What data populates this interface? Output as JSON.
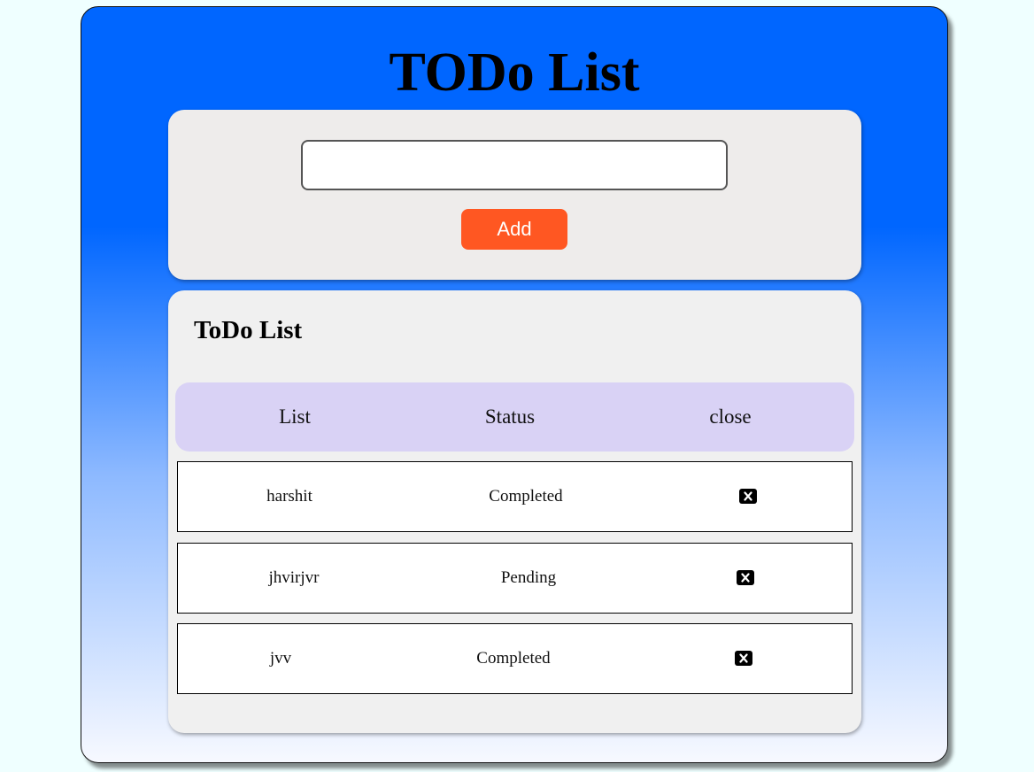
{
  "app": {
    "title": "TODo List"
  },
  "form": {
    "input_value": "",
    "input_placeholder": "",
    "add_label": "Add"
  },
  "list": {
    "title": "ToDo List",
    "headers": {
      "list": "List",
      "status": "Status",
      "close": "close"
    },
    "items": [
      {
        "name": "harshit",
        "status": "Completed",
        "close_icon": "close-icon"
      },
      {
        "name": "jhvirjvr",
        "status": "Pending",
        "close_icon": "close-icon"
      },
      {
        "name": "jvv",
        "status": "Completed",
        "close_icon": "close-icon"
      }
    ]
  },
  "colors": {
    "page_background": "#efffff",
    "card_gradient_top": "#0066ff",
    "card_gradient_bottom": "#f7f9ff",
    "panel_background": "#eeeceb",
    "header_background": "#d9d2f5",
    "add_button": "#ff5722"
  }
}
